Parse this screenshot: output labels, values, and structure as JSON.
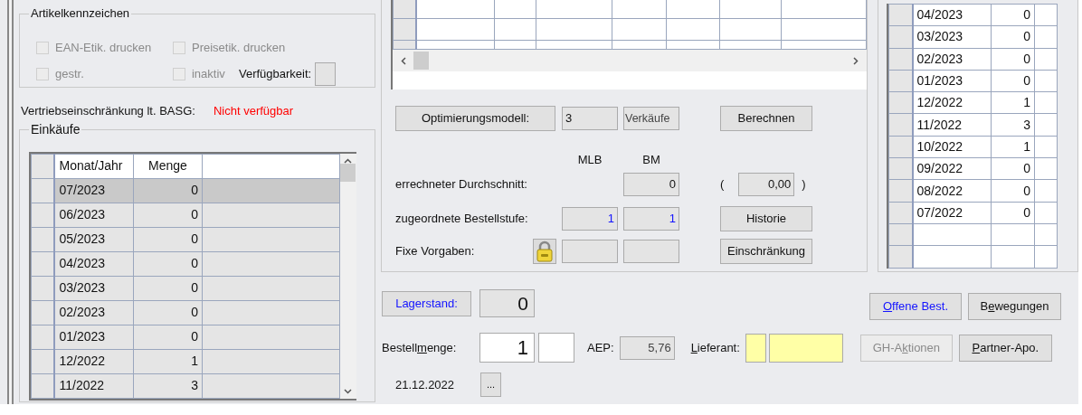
{
  "artikelkennzeichen": {
    "title": "Artikelkennzeichen",
    "checkboxes": [
      {
        "label": "EAN-Etik. drucken",
        "checked": false,
        "disabled": true
      },
      {
        "label": "Preisetik. drucken",
        "checked": false,
        "disabled": true
      },
      {
        "label": "gestr.",
        "checked": false,
        "disabled": true
      },
      {
        "label": "inaktiv",
        "checked": false,
        "disabled": true
      }
    ],
    "verfuegbarkeit": {
      "label": "Verfügbarkeit:"
    }
  },
  "vertriebseinschraenkung": {
    "label": "Vertriebseinschränkung lt. BASG:",
    "value": "Nicht verfügbar"
  },
  "einkaeufe": {
    "title": "Einkäufe",
    "columns": [
      "Monat/Jahr",
      "Menge"
    ],
    "rows": [
      {
        "month": "07/2023",
        "qty": "0",
        "selected": true
      },
      {
        "month": "06/2023",
        "qty": "0",
        "selected": false
      },
      {
        "month": "05/2023",
        "qty": "0",
        "selected": false
      },
      {
        "month": "04/2023",
        "qty": "0",
        "selected": false
      },
      {
        "month": "03/2023",
        "qty": "0",
        "selected": false
      },
      {
        "month": "02/2023",
        "qty": "0",
        "selected": false
      },
      {
        "month": "01/2023",
        "qty": "0",
        "selected": false
      },
      {
        "month": "12/2022",
        "qty": "1",
        "selected": false
      },
      {
        "month": "11/2022",
        "qty": "3",
        "selected": false
      }
    ]
  },
  "optimierung": {
    "model_button": "Optimierungsmodell:",
    "model_value": "3",
    "model_basis": "Verkäufe",
    "calc_button": "Berechnen",
    "headers": [
      "MLB",
      "BM"
    ],
    "durchschnitt": {
      "label": "errechneter Durchschnitt:",
      "bm": "0",
      "open": "(",
      "value": "0,00",
      "close": ")"
    },
    "bestellstufe": {
      "label": "zugeordnete Bestellstufe:",
      "mlb": "1",
      "bm": "1",
      "button": "Historie"
    },
    "fixe": {
      "label": "Fixe Vorgaben:",
      "button": "Einschränkung"
    }
  },
  "verkaeufe": {
    "rows": [
      {
        "month": "04/2023",
        "qty": "0"
      },
      {
        "month": "03/2023",
        "qty": "0"
      },
      {
        "month": "02/2023",
        "qty": "0"
      },
      {
        "month": "01/2023",
        "qty": "0"
      },
      {
        "month": "12/2022",
        "qty": "1"
      },
      {
        "month": "11/2022",
        "qty": "3"
      },
      {
        "month": "10/2022",
        "qty": "1"
      },
      {
        "month": "09/2022",
        "qty": "0"
      },
      {
        "month": "08/2022",
        "qty": "0"
      },
      {
        "month": "07/2022",
        "qty": "0"
      }
    ]
  },
  "bottom": {
    "lagerstand": {
      "button": "Lagerstand:",
      "value": "0"
    },
    "bestellmenge": {
      "label_before": "Bestell",
      "mnemonic": "m",
      "label_after": "enge:",
      "value": "1"
    },
    "aep": {
      "label": "AEP:",
      "value": "5,76"
    },
    "lieferant": {
      "mnemonic": "L",
      "label_after": "ieferant:"
    },
    "date": "21.12.2022",
    "date_button": "...",
    "buttons": [
      {
        "mnemonic": "O",
        "label_after": "ffene Best.",
        "kind": "link",
        "disabled": false
      },
      {
        "label_before": "B",
        "mnemonic": "e",
        "label_after": "wegungen",
        "kind": "normal",
        "disabled": false
      },
      {
        "label_before": "GH-A",
        "mnemonic": "k",
        "label_after": "tionen",
        "kind": "normal",
        "disabled": true
      },
      {
        "mnemonic": "P",
        "label_after": "artner-Apo.",
        "kind": "normal",
        "disabled": false
      }
    ]
  }
}
